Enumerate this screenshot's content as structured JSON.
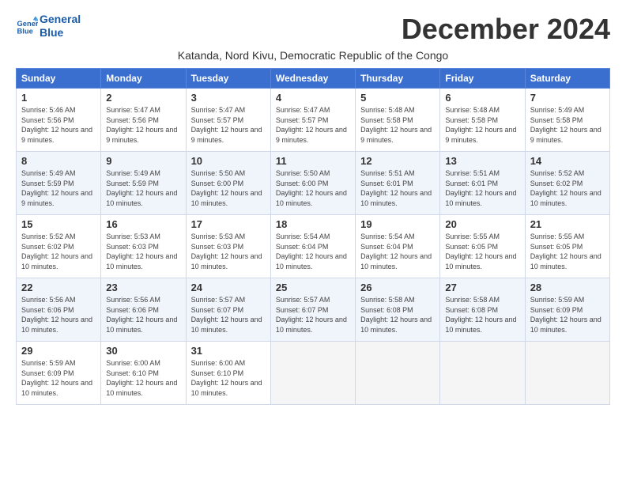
{
  "logo": {
    "line1": "General",
    "line2": "Blue"
  },
  "title": "December 2024",
  "location": "Katanda, Nord Kivu, Democratic Republic of the Congo",
  "days_of_week": [
    "Sunday",
    "Monday",
    "Tuesday",
    "Wednesday",
    "Thursday",
    "Friday",
    "Saturday"
  ],
  "weeks": [
    [
      {
        "day": "1",
        "sunrise": "5:46 AM",
        "sunset": "5:56 PM",
        "daylight": "12 hours and 9 minutes."
      },
      {
        "day": "2",
        "sunrise": "5:47 AM",
        "sunset": "5:56 PM",
        "daylight": "12 hours and 9 minutes."
      },
      {
        "day": "3",
        "sunrise": "5:47 AM",
        "sunset": "5:57 PM",
        "daylight": "12 hours and 9 minutes."
      },
      {
        "day": "4",
        "sunrise": "5:47 AM",
        "sunset": "5:57 PM",
        "daylight": "12 hours and 9 minutes."
      },
      {
        "day": "5",
        "sunrise": "5:48 AM",
        "sunset": "5:58 PM",
        "daylight": "12 hours and 9 minutes."
      },
      {
        "day": "6",
        "sunrise": "5:48 AM",
        "sunset": "5:58 PM",
        "daylight": "12 hours and 9 minutes."
      },
      {
        "day": "7",
        "sunrise": "5:49 AM",
        "sunset": "5:58 PM",
        "daylight": "12 hours and 9 minutes."
      }
    ],
    [
      {
        "day": "8",
        "sunrise": "5:49 AM",
        "sunset": "5:59 PM",
        "daylight": "12 hours and 9 minutes."
      },
      {
        "day": "9",
        "sunrise": "5:49 AM",
        "sunset": "5:59 PM",
        "daylight": "12 hours and 10 minutes."
      },
      {
        "day": "10",
        "sunrise": "5:50 AM",
        "sunset": "6:00 PM",
        "daylight": "12 hours and 10 minutes."
      },
      {
        "day": "11",
        "sunrise": "5:50 AM",
        "sunset": "6:00 PM",
        "daylight": "12 hours and 10 minutes."
      },
      {
        "day": "12",
        "sunrise": "5:51 AM",
        "sunset": "6:01 PM",
        "daylight": "12 hours and 10 minutes."
      },
      {
        "day": "13",
        "sunrise": "5:51 AM",
        "sunset": "6:01 PM",
        "daylight": "12 hours and 10 minutes."
      },
      {
        "day": "14",
        "sunrise": "5:52 AM",
        "sunset": "6:02 PM",
        "daylight": "12 hours and 10 minutes."
      }
    ],
    [
      {
        "day": "15",
        "sunrise": "5:52 AM",
        "sunset": "6:02 PM",
        "daylight": "12 hours and 10 minutes."
      },
      {
        "day": "16",
        "sunrise": "5:53 AM",
        "sunset": "6:03 PM",
        "daylight": "12 hours and 10 minutes."
      },
      {
        "day": "17",
        "sunrise": "5:53 AM",
        "sunset": "6:03 PM",
        "daylight": "12 hours and 10 minutes."
      },
      {
        "day": "18",
        "sunrise": "5:54 AM",
        "sunset": "6:04 PM",
        "daylight": "12 hours and 10 minutes."
      },
      {
        "day": "19",
        "sunrise": "5:54 AM",
        "sunset": "6:04 PM",
        "daylight": "12 hours and 10 minutes."
      },
      {
        "day": "20",
        "sunrise": "5:55 AM",
        "sunset": "6:05 PM",
        "daylight": "12 hours and 10 minutes."
      },
      {
        "day": "21",
        "sunrise": "5:55 AM",
        "sunset": "6:05 PM",
        "daylight": "12 hours and 10 minutes."
      }
    ],
    [
      {
        "day": "22",
        "sunrise": "5:56 AM",
        "sunset": "6:06 PM",
        "daylight": "12 hours and 10 minutes."
      },
      {
        "day": "23",
        "sunrise": "5:56 AM",
        "sunset": "6:06 PM",
        "daylight": "12 hours and 10 minutes."
      },
      {
        "day": "24",
        "sunrise": "5:57 AM",
        "sunset": "6:07 PM",
        "daylight": "12 hours and 10 minutes."
      },
      {
        "day": "25",
        "sunrise": "5:57 AM",
        "sunset": "6:07 PM",
        "daylight": "12 hours and 10 minutes."
      },
      {
        "day": "26",
        "sunrise": "5:58 AM",
        "sunset": "6:08 PM",
        "daylight": "12 hours and 10 minutes."
      },
      {
        "day": "27",
        "sunrise": "5:58 AM",
        "sunset": "6:08 PM",
        "daylight": "12 hours and 10 minutes."
      },
      {
        "day": "28",
        "sunrise": "5:59 AM",
        "sunset": "6:09 PM",
        "daylight": "12 hours and 10 minutes."
      }
    ],
    [
      {
        "day": "29",
        "sunrise": "5:59 AM",
        "sunset": "6:09 PM",
        "daylight": "12 hours and 10 minutes."
      },
      {
        "day": "30",
        "sunrise": "6:00 AM",
        "sunset": "6:10 PM",
        "daylight": "12 hours and 10 minutes."
      },
      {
        "day": "31",
        "sunrise": "6:00 AM",
        "sunset": "6:10 PM",
        "daylight": "12 hours and 10 minutes."
      },
      null,
      null,
      null,
      null
    ]
  ]
}
